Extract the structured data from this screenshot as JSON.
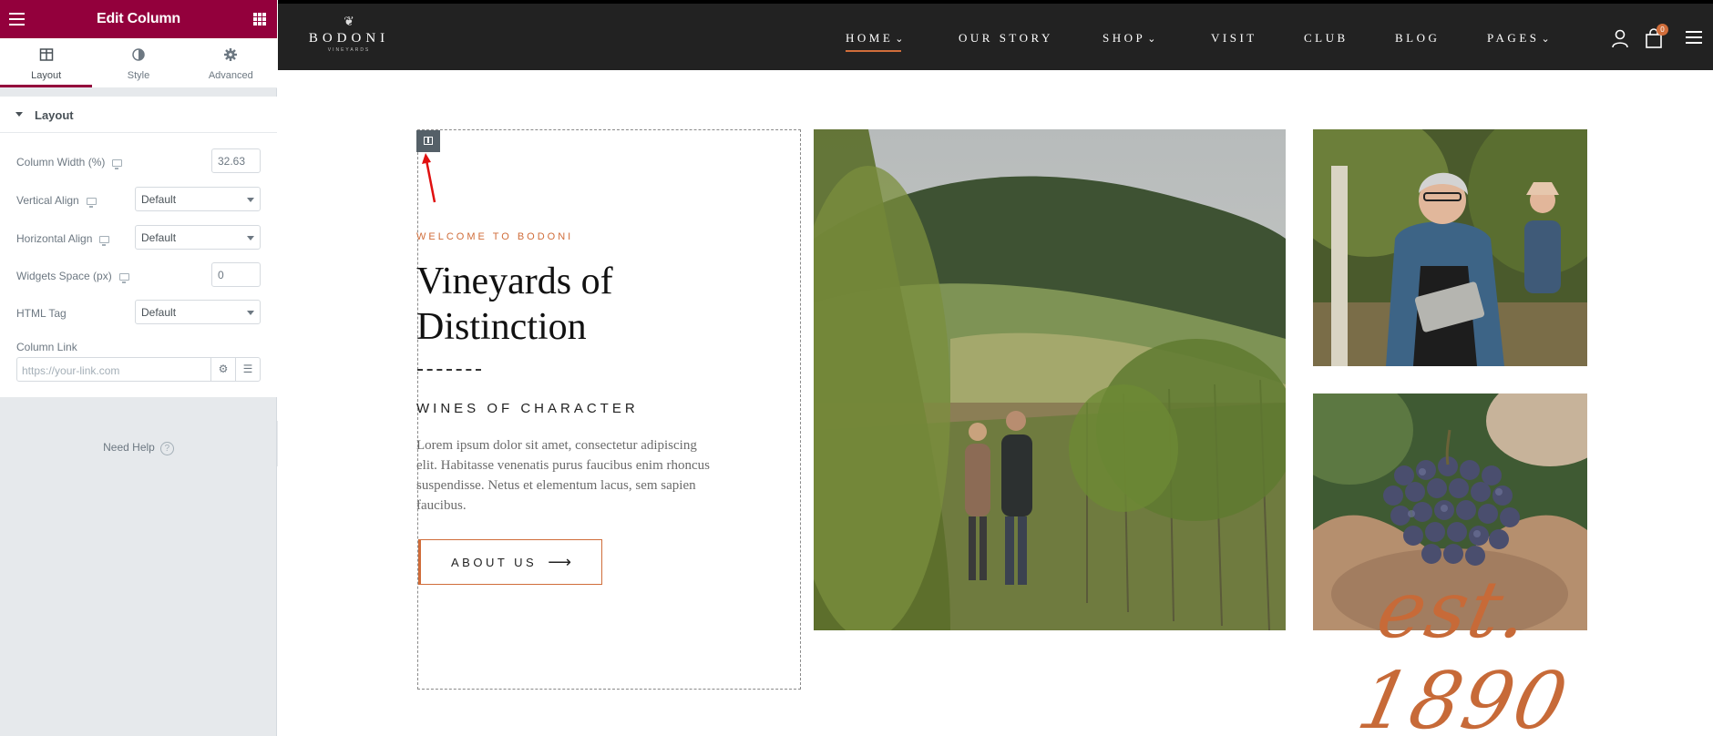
{
  "panel": {
    "title": "Edit Column",
    "tabs": [
      {
        "label": "Layout",
        "icon": "columns-icon",
        "active": true
      },
      {
        "label": "Style",
        "icon": "contrast-icon",
        "active": false
      },
      {
        "label": "Advanced",
        "icon": "gear-icon",
        "active": false
      }
    ],
    "section_label": "Layout",
    "controls": {
      "column_width": {
        "label": "Column Width (%)",
        "value": "32.63"
      },
      "vertical_align": {
        "label": "Vertical Align",
        "value": "Default"
      },
      "horizontal_align": {
        "label": "Horizontal Align",
        "value": "Default"
      },
      "widgets_space": {
        "label": "Widgets Space (px)",
        "value": "0"
      },
      "html_tag": {
        "label": "HTML Tag",
        "value": "Default"
      },
      "column_link": {
        "label": "Column Link",
        "placeholder": "https://your-link.com"
      }
    },
    "need_help": "Need Help",
    "accent_color": "#93003c"
  },
  "site": {
    "logo": {
      "name": "BODONI",
      "sub": "VINEYARDS"
    },
    "nav": [
      {
        "label": "HOME",
        "dropdown": true,
        "active": true
      },
      {
        "label": "OUR STORY",
        "dropdown": false,
        "active": false
      },
      {
        "label": "SHOP",
        "dropdown": true,
        "active": false
      },
      {
        "label": "VISIT",
        "dropdown": false,
        "active": false
      },
      {
        "label": "CLUB",
        "dropdown": false,
        "active": false
      },
      {
        "label": "BLOG",
        "dropdown": false,
        "active": false
      },
      {
        "label": "PAGES",
        "dropdown": true,
        "active": false
      }
    ],
    "cart_count": "0",
    "hero": {
      "eyebrow": "WELCOME TO BODONI",
      "headline": "Vineyards of Distinction",
      "subhead": "WINES OF CHARACTER",
      "body": "Lorem ipsum dolor sit amet, consectetur adipiscing elit. Habitasse venenatis purus faucibus enim rhoncus suspendisse. Netus et elementum lacus, sem sapien faucibus.",
      "button": "ABOUT US",
      "established": "est. 1890"
    },
    "accent_color": "#d06d3a"
  }
}
